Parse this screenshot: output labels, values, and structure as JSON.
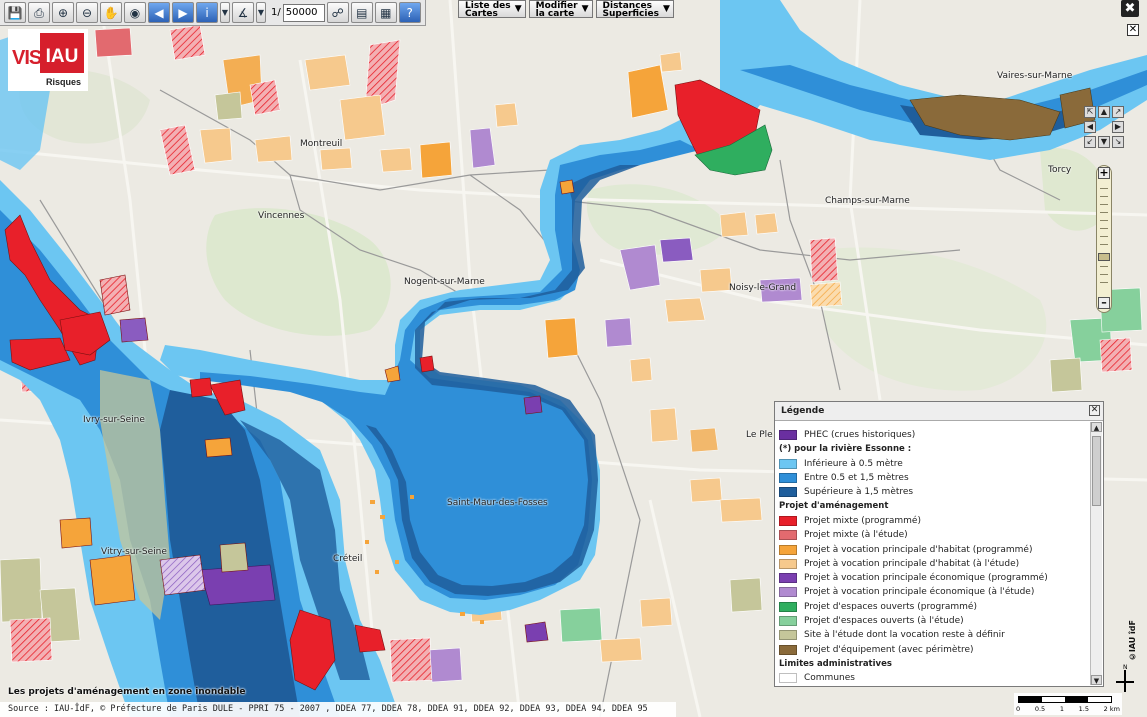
{
  "toolbar": {
    "scale_prefix": "1/",
    "scale_value": "50000",
    "icons": [
      "save-icon",
      "print-icon",
      "zoom-in-icon",
      "zoom-out-icon",
      "pan-hand-icon",
      "globe-icon",
      "back-arrow-icon",
      "forward-arrow-icon",
      "info-icon",
      "measure-icon",
      "binoculars-icon",
      "layers-icon",
      "report-icon",
      "help-icon"
    ]
  },
  "menus": [
    {
      "label": "Liste des\nCartes"
    },
    {
      "label": "Modifier\nla carte"
    },
    {
      "label": "Distances\nSuperficies"
    }
  ],
  "logo": {
    "brand": "VISI",
    "brand_box": "IAU",
    "subtitle": "Risques"
  },
  "places": [
    {
      "name": "Montreuil"
    },
    {
      "name": "Vincennes"
    },
    {
      "name": "Nogent-sur-Marne"
    },
    {
      "name": "Noisy-le-Grand"
    },
    {
      "name": "Champs-sur-Marne"
    },
    {
      "name": "Vaires-sur-Marne"
    },
    {
      "name": "Torcy"
    },
    {
      "name": "Ivry-sur-Seine"
    },
    {
      "name": "Vitry-sur-Seine"
    },
    {
      "name": "Créteil"
    },
    {
      "name": "Saint-Maur-des-Fosses"
    },
    {
      "name": "Le Ple"
    }
  ],
  "legend": {
    "title": "Légende",
    "cut_top": "PHEC (crues historiques)",
    "rows": [
      {
        "kind": "item",
        "label": "PHEC (crues historiques)",
        "color": "#6a2fa0"
      },
      {
        "kind": "head",
        "label": "(*) pour la rivière Essonne :"
      },
      {
        "kind": "item",
        "label": "Inférieure à 0.5 mètre",
        "color": "#6cc6f2"
      },
      {
        "kind": "item",
        "label": "Entre 0.5 et 1,5 mètres",
        "color": "#2f8fd8"
      },
      {
        "kind": "item",
        "label": "Supérieure à 1,5 mètres",
        "color": "#1f5e9c"
      },
      {
        "kind": "head",
        "label": "Projet d'aménagement"
      },
      {
        "kind": "item",
        "label": "Projet mixte (programmé)",
        "color": "#e8202a"
      },
      {
        "kind": "item",
        "label": "Projet mixte (à l'étude)",
        "color": "#e26a6f"
      },
      {
        "kind": "item",
        "label": "Projet à vocation principale d'habitat (programmé)",
        "color": "#f5a43a"
      },
      {
        "kind": "item",
        "label": "Projet à vocation principale d'habitat (à l'étude)",
        "color": "#f6c98d"
      },
      {
        "kind": "item",
        "label": "Projet à vocation principale économique (programmé)",
        "color": "#7a3fb0"
      },
      {
        "kind": "item",
        "label": "Projet à vocation principale économique (à l'étude)",
        "color": "#b08ad0"
      },
      {
        "kind": "item",
        "label": "Projet d'espaces ouverts (programmé)",
        "color": "#2fae5f"
      },
      {
        "kind": "item",
        "label": "Projet d'espaces ouverts (à l'étude)",
        "color": "#86d09c"
      },
      {
        "kind": "item",
        "label": "Site à l'étude dont la vocation reste à définir",
        "color": "#c5c69a"
      },
      {
        "kind": "item",
        "label": "Projet d'équipement (avec périmètre)",
        "color": "#8a6a3a"
      },
      {
        "kind": "head",
        "label": "Limites administratives"
      },
      {
        "kind": "item",
        "label": "Communes",
        "color": "#ffffff"
      }
    ]
  },
  "footer": {
    "title": "Les projets d'aménagement en zone inondable",
    "source": "Source : IAU-ÎdF, © Préfecture de Paris DULE  - PPRI 75 - 2007 , DDEA 77, DDEA 78, DDEA 91, DDEA 92, DDEA 93, DDEA 94, DDEA 95"
  },
  "scalebar": {
    "labels": [
      "0",
      "0.5",
      "1",
      "1.5",
      "2 km"
    ]
  },
  "copyright": "©IAU îdF",
  "colors": {
    "water_light": "#6cc6f2",
    "water_mid": "#2f8fd8",
    "water_deep": "#1f5e9c",
    "background": "#eceae3"
  }
}
